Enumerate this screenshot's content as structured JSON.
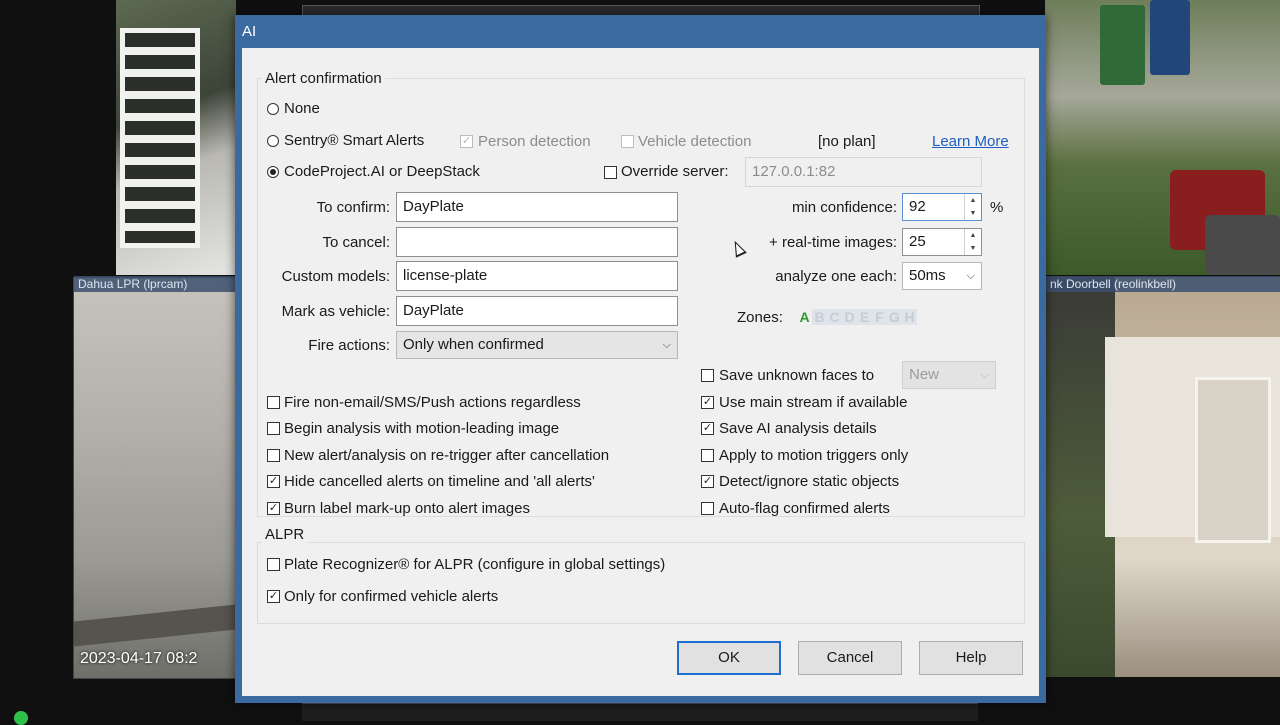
{
  "background": {
    "cam_left_label": "Dahua LPR (lprcam)",
    "cam_right_label": "nk Doorbell (reolinkbell)",
    "timestamp": "2023-04-17 08:2"
  },
  "dialog": {
    "title": "AI",
    "alert_confirmation": {
      "group_label": "Alert confirmation",
      "none_label": "None",
      "sentry_label": "Sentry® Smart Alerts",
      "person_detection_label": "Person detection",
      "vehicle_detection_label": "Vehicle detection",
      "no_plan_text": "[no plan]",
      "learn_more_label": "Learn More",
      "codeproject_label": "CodeProject.AI or DeepStack",
      "override_server_label": "Override server:",
      "server_value": "127.0.0.1:82",
      "to_confirm_label": "To confirm:",
      "to_confirm_value": "DayPlate",
      "to_cancel_label": "To cancel:",
      "to_cancel_value": "",
      "custom_models_label": "Custom models:",
      "custom_models_value": "license-plate",
      "mark_vehicle_label": "Mark as vehicle:",
      "mark_vehicle_value": "DayPlate",
      "fire_actions_label": "Fire actions:",
      "fire_actions_value": "Only when confirmed",
      "min_confidence_label": "min confidence:",
      "min_confidence_value": "92",
      "percent_sign": "%",
      "realtime_images_label": "+ real-time images:",
      "realtime_images_value": "25",
      "analyze_each_label": "analyze one each:",
      "analyze_each_value": "50ms",
      "zones_label": "Zones:",
      "zones": [
        "A",
        "B",
        "C",
        "D",
        "E",
        "F",
        "G",
        "H"
      ],
      "save_faces_label": "Save unknown faces to",
      "save_faces_value": "New",
      "left_options": [
        {
          "label": "Fire non-email/SMS/Push actions regardless",
          "checked": false
        },
        {
          "label": "Begin analysis with motion-leading image",
          "checked": false
        },
        {
          "label": "New alert/analysis on re-trigger after cancellation",
          "checked": false
        },
        {
          "label": "Hide cancelled alerts on timeline and  'all alerts'",
          "checked": true
        },
        {
          "label": "Burn label mark-up onto alert images",
          "checked": true
        }
      ],
      "right_options": [
        {
          "label": "Use main stream if available",
          "checked": true
        },
        {
          "label": "Save AI analysis details",
          "checked": true
        },
        {
          "label": "Apply to motion triggers only",
          "checked": false
        },
        {
          "label": "Detect/ignore static objects",
          "checked": true
        },
        {
          "label": "Auto-flag confirmed alerts",
          "checked": false
        }
      ]
    },
    "alpr": {
      "group_label": "ALPR",
      "plate_recognizer_label": "Plate Recognizer® for ALPR (configure in global settings)",
      "only_confirmed_label": "Only for confirmed vehicle alerts"
    },
    "buttons": {
      "ok": "OK",
      "cancel": "Cancel",
      "help": "Help"
    },
    "check_mark": "✓"
  }
}
